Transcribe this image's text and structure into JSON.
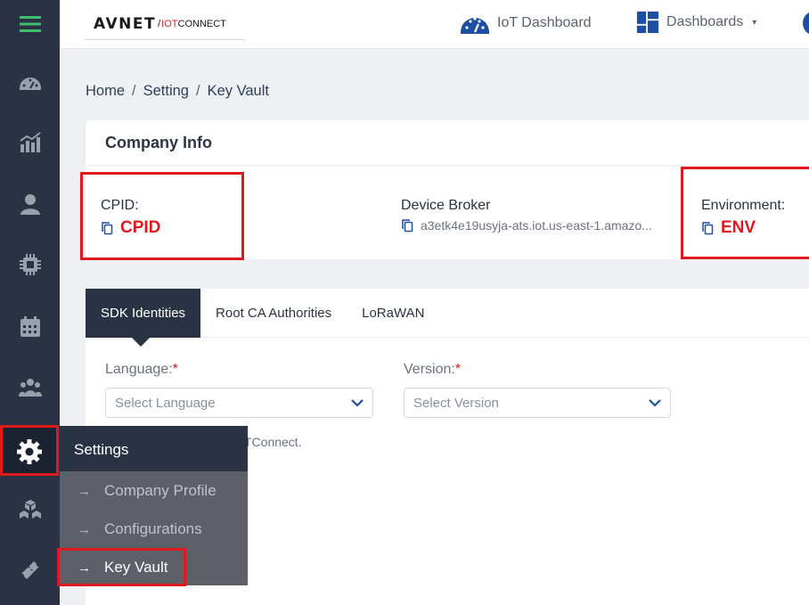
{
  "brand": {
    "logo_main": "AVNET",
    "logo_sep": "/",
    "logo_iot": "IOT",
    "logo_connect": "CONNECT"
  },
  "topbar": {
    "iot_dashboard": "IoT Dashboard",
    "dashboards": "Dashboards",
    "dashboards_caret": "▾"
  },
  "sidebar": {
    "items": [
      {
        "name": "menu-icon"
      },
      {
        "name": "dashboard-gauge-icon"
      },
      {
        "name": "analytics-chart-icon"
      },
      {
        "name": "user-icon"
      },
      {
        "name": "chip-icon"
      },
      {
        "name": "calendar-icon"
      },
      {
        "name": "group-users-icon"
      },
      {
        "name": "gear-icon"
      },
      {
        "name": "cubes-icon"
      },
      {
        "name": "ticket-icon"
      }
    ]
  },
  "breadcrumb": {
    "home": "Home",
    "setting": "Setting",
    "current": "Key Vault",
    "sep": "/"
  },
  "company": {
    "title": "Company Info",
    "cpid_label": "CPID:",
    "cpid_value": "CPID",
    "broker_label": "Device Broker",
    "broker_value": "a3etk4e19usyja-ats.iot.us-east-1.amazo...",
    "env_label": "Environment:",
    "env_value": "ENV"
  },
  "tabs": [
    {
      "label": "SDK Identities"
    },
    {
      "label": "Root CA Authorities"
    },
    {
      "label": "LoRaWAN"
    }
  ],
  "form": {
    "language_label": "Language:",
    "language_placeholder": "Select Language",
    "version_label": "Version:",
    "version_placeholder": "Select Version",
    "required_mark": "*",
    "partial_text": "TConnect."
  },
  "flyout": {
    "title": "Settings",
    "items": [
      {
        "label": "Company Profile",
        "arrow": "→"
      },
      {
        "label": "Configurations",
        "arrow": "→"
      },
      {
        "label": "Key Vault",
        "arrow": "→"
      }
    ]
  },
  "colors": {
    "sidebar": "#2a3344",
    "accent_red": "#e0191f",
    "brand_blue": "#1d4fa3",
    "menu_green": "#3fbf6a"
  }
}
